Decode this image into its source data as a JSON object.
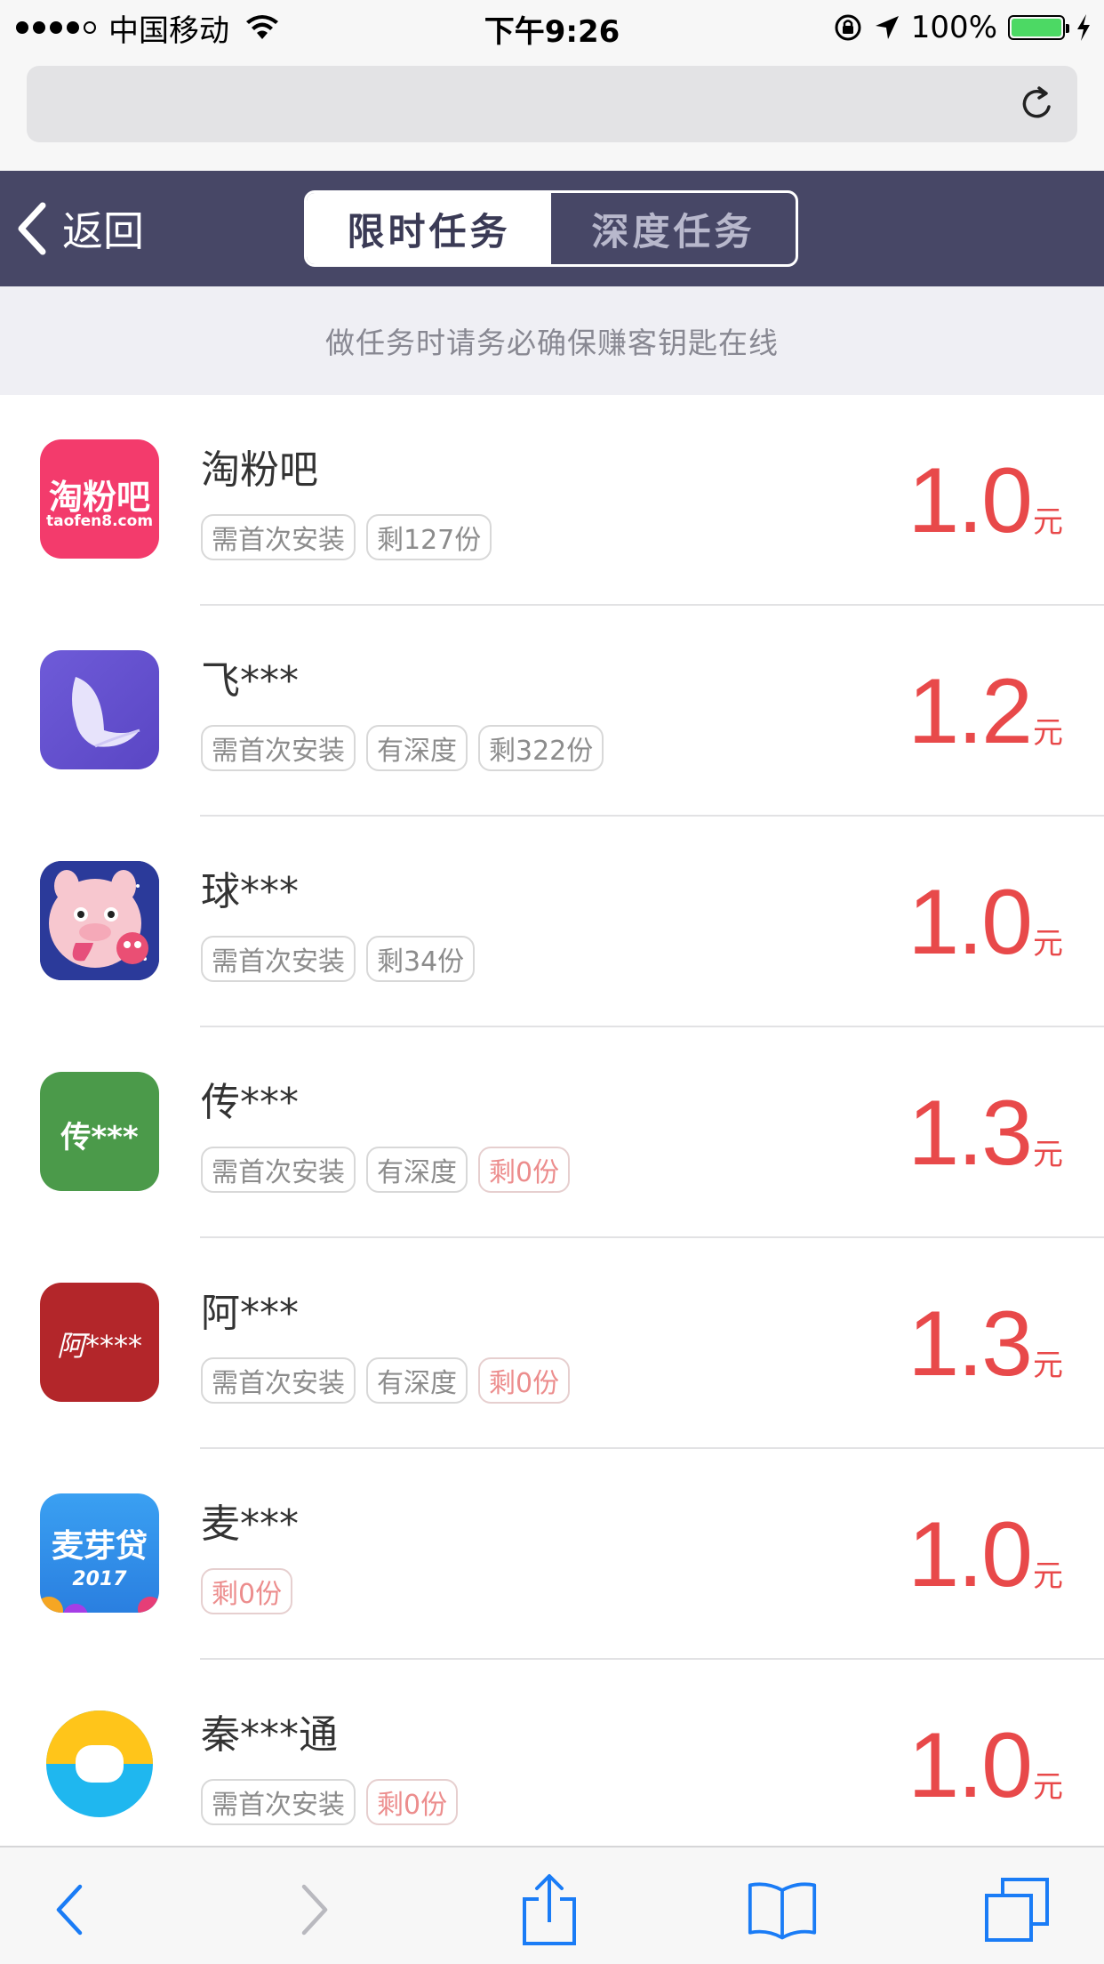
{
  "status_bar": {
    "carrier": "中国移动",
    "time": "下午9:26",
    "battery": "100%",
    "signal_icon": "signal-dots-icon",
    "wifi_icon": "wifi-icon",
    "lock_icon": "rotation-lock-icon",
    "location_icon": "location-arrow-icon",
    "charging_icon": "charging-bolt-icon",
    "battery_level": 1.0
  },
  "browser": {
    "url": "",
    "reload_icon": "reload-icon"
  },
  "header": {
    "back_label": "返回",
    "tabs": [
      {
        "label": "限时任务",
        "active": true
      },
      {
        "label": "深度任务",
        "active": false
      }
    ]
  },
  "notice": "做任务时请务必确保赚客钥匙在线",
  "tasks": [
    {
      "name": "淘粉吧",
      "icon_text": "淘粉吧",
      "icon_subtext": "taofen8.com",
      "tags": [
        "需首次安装",
        "剩127份"
      ],
      "price": "1.0",
      "unit": "元"
    },
    {
      "name": "飞***",
      "tags": [
        "需首次安装",
        "有深度",
        "剩322份"
      ],
      "price": "1.2",
      "unit": "元"
    },
    {
      "name": "球***",
      "tags": [
        "需首次安装",
        "剩34份"
      ],
      "price": "1.0",
      "unit": "元"
    },
    {
      "name": "传***",
      "icon_text": "传***",
      "tags": [
        "需首次安装",
        "有深度",
        "剩0份"
      ],
      "price": "1.3",
      "unit": "元"
    },
    {
      "name": "阿***",
      "icon_text": "阿****",
      "tags": [
        "需首次安装",
        "有深度",
        "剩0份"
      ],
      "price": "1.3",
      "unit": "元"
    },
    {
      "name": "麦***",
      "icon_text": "麦芽贷",
      "icon_subtext": "2017",
      "tags": [
        "剩0份"
      ],
      "price": "1.0",
      "unit": "元"
    },
    {
      "name": "秦***通",
      "tags": [
        "需首次安装",
        "剩0份"
      ],
      "price": "1.0",
      "unit": "元"
    }
  ],
  "toolbar": {
    "back_icon": "back-arrow-icon",
    "forward_icon": "forward-arrow-icon",
    "share_icon": "share-icon",
    "bookmarks_icon": "bookmarks-book-icon",
    "tabs_icon": "tabs-icon"
  },
  "colors": {
    "header_bg": "#474766",
    "price": "#e8494a",
    "notice_bg": "#efeff4",
    "ios_blue": "#1a7cf6"
  }
}
